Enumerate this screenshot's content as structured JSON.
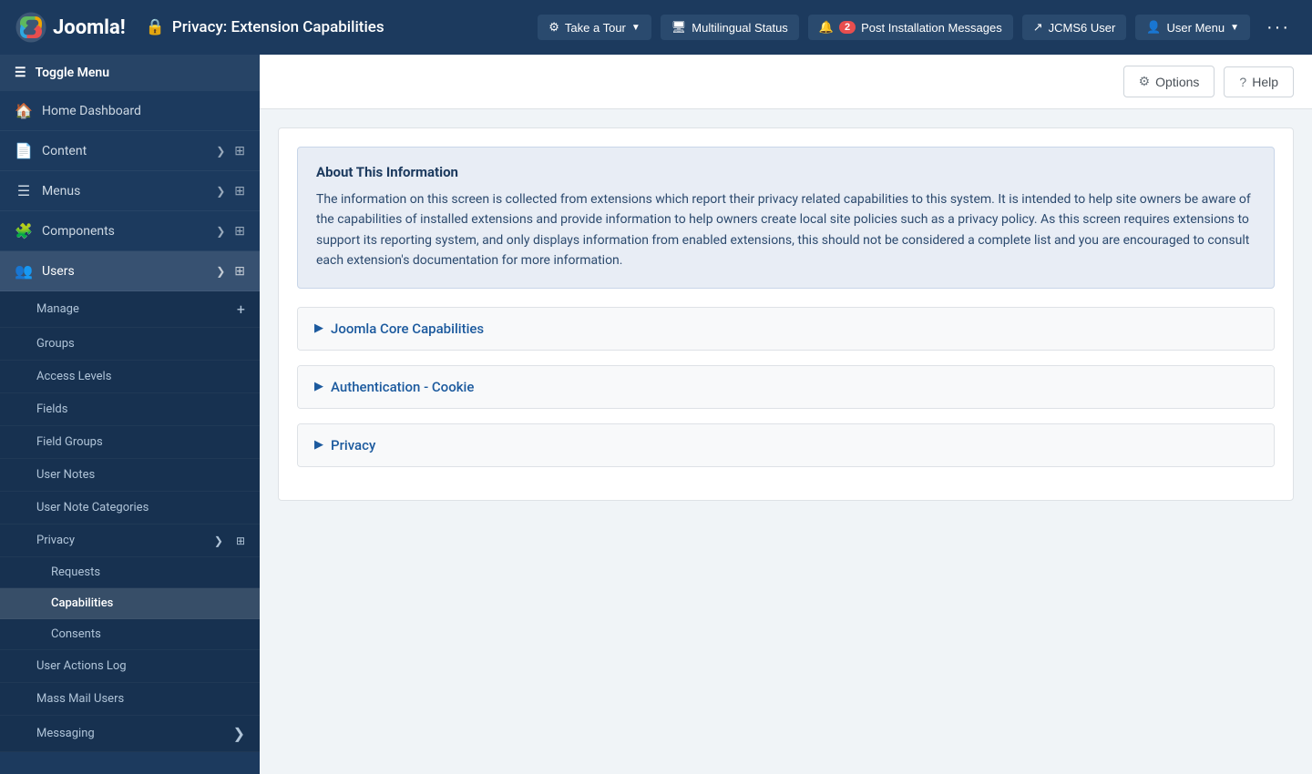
{
  "topbar": {
    "logo_text": "Joomla!",
    "page_title": "Privacy: Extension Capabilities",
    "take_a_tour_label": "Take a Tour",
    "multilingual_status_label": "Multilingual Status",
    "notification_count": "2",
    "post_installation_label": "Post Installation Messages",
    "jcms_user_label": "JCMS6 User",
    "user_menu_label": "User Menu",
    "more_icon": "···"
  },
  "toolbar": {
    "options_label": "Options",
    "help_label": "Help"
  },
  "sidebar": {
    "toggle_label": "Toggle Menu",
    "home_label": "Home Dashboard",
    "items": [
      {
        "label": "Content",
        "icon": "📄",
        "has_arrow": true,
        "has_grid": true
      },
      {
        "label": "Menus",
        "icon": "☰",
        "has_arrow": true,
        "has_grid": true
      },
      {
        "label": "Components",
        "icon": "🧩",
        "has_arrow": true,
        "has_grid": true
      },
      {
        "label": "Users",
        "icon": "👥",
        "has_arrow": true,
        "expanded": true,
        "has_grid": true
      }
    ],
    "users_sub": [
      {
        "label": "Manage",
        "has_add": true
      },
      {
        "label": "Groups"
      },
      {
        "label": "Access Levels"
      },
      {
        "label": "Fields"
      },
      {
        "label": "Field Groups"
      },
      {
        "label": "User Notes"
      },
      {
        "label": "User Note Categories"
      },
      {
        "label": "Privacy",
        "has_arrow": true,
        "expanded": true,
        "has_grid": true
      }
    ],
    "privacy_sub": [
      {
        "label": "Requests"
      },
      {
        "label": "Capabilities",
        "active": true
      },
      {
        "label": "Consents"
      }
    ],
    "bottom_items": [
      {
        "label": "User Actions Log"
      },
      {
        "label": "Mass Mail Users"
      },
      {
        "label": "Messaging",
        "has_arrow": true
      }
    ]
  },
  "info_box": {
    "title": "About This Information",
    "text": "The information on this screen is collected from extensions which report their privacy related capabilities to this system. It is intended to help site owners be aware of the capabilities of installed extensions and provide information to help owners create local site policies such as a privacy policy. As this screen requires extensions to support its reporting system, and only displays information from enabled extensions, this should not be considered a complete list and you are encouraged to consult each extension's documentation for more information."
  },
  "collapsibles": [
    {
      "title": "Joomla Core Capabilities"
    },
    {
      "title": "Authentication - Cookie"
    },
    {
      "title": "Privacy"
    }
  ]
}
